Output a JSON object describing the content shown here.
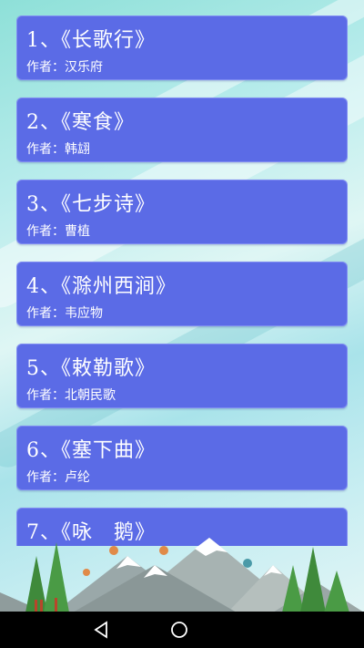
{
  "poems": [
    {
      "title": "1、《长歌行》",
      "author": "作者：汉乐府"
    },
    {
      "title": "2、《寒食》",
      "author": "作者：韩翃"
    },
    {
      "title": "3、《七步诗》",
      "author": "作者：曹植"
    },
    {
      "title": "4、《滁州西涧》",
      "author": "作者：韦应物"
    },
    {
      "title": "5、《敕勒歌》",
      "author": "作者：北朝民歌"
    },
    {
      "title": "6、《塞下曲》",
      "author": "作者：卢纶"
    },
    {
      "title": "7、《咏　鹅》",
      "author": ""
    }
  ],
  "colors": {
    "card_bg": "#5b6be6",
    "card_border": "#7f8cf2",
    "nav_bg": "#000000"
  },
  "icons": {
    "nav_back": "back-triangle-icon",
    "nav_home": "home-circle-icon"
  }
}
